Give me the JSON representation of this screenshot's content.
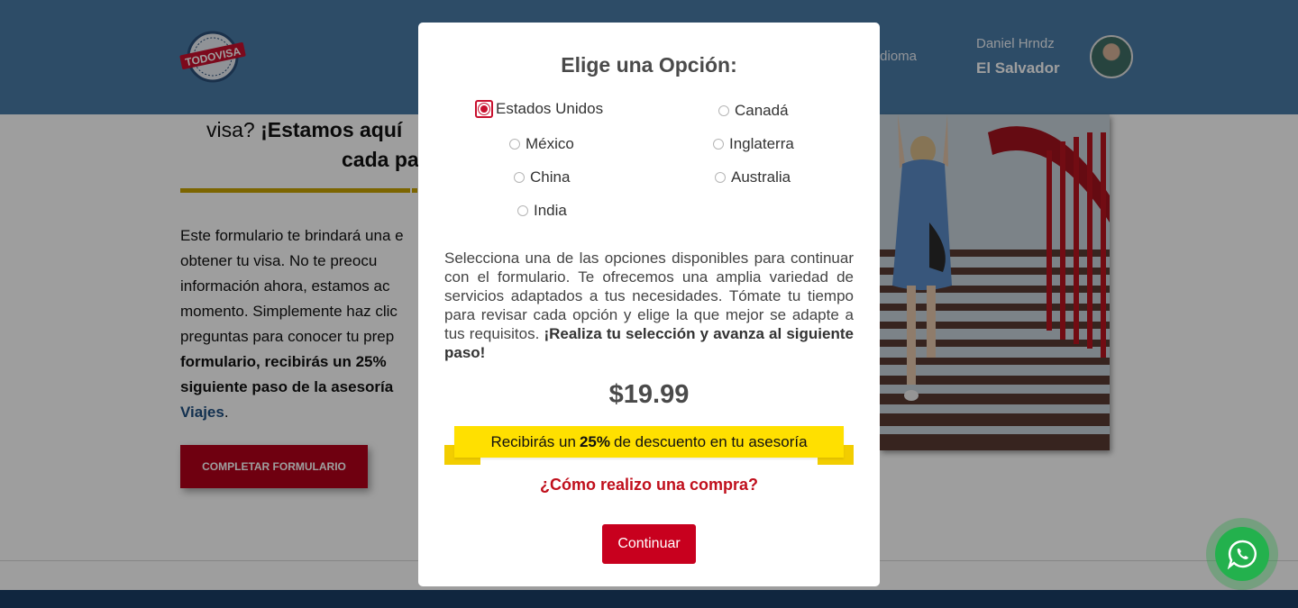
{
  "header": {
    "logo_text": "TODOVISA",
    "nav_idioma": "Idioma",
    "user_name": "Daniel Hrndz",
    "user_country": "El Salvador"
  },
  "hero": {
    "title_line1_prefix": "visa? ",
    "title_line1_bold": "¡Estamos aquí",
    "title_line2": "cada pa",
    "paragraph_lines": [
      "Este formulario te brindará una e",
      "obtener tu visa. No te preocu",
      "información ahora, estamos ac",
      "momento. Simplemente haz clic",
      "preguntas para conocer tu prep"
    ],
    "paragraph_bold_lines": [
      "formulario, recibirás un 25%",
      "siguiente paso de la asesoría"
    ],
    "paragraph_link": "Viajes",
    "paragraph_end": ".",
    "cta_label": "COMPLETAR FORMULARIO"
  },
  "modal": {
    "title": "Elige una Opción:",
    "options": [
      {
        "label": "Estados Unidos",
        "selected": true
      },
      {
        "label": "Canadá",
        "selected": false
      },
      {
        "label": "México",
        "selected": false
      },
      {
        "label": "Inglaterra",
        "selected": false
      },
      {
        "label": "China",
        "selected": false
      },
      {
        "label": "Australia",
        "selected": false
      },
      {
        "label": "India",
        "selected": false
      }
    ],
    "description": "Selecciona una de las opciones disponibles para continuar con el formulario. Te ofrecemos una amplia variedad de servicios adaptados a tus necesidades. Tómate tu tiempo para revisar cada opción y elige la que mejor se adapte a tus requisitos.",
    "description_bold": "¡Realiza tu selección y avanza al siguiente paso!",
    "price": "$19.99",
    "ribbon_prefix": "Recibirás un",
    "ribbon_bold": "25%",
    "ribbon_suffix": "de descuento en tu asesoría",
    "how_link": "¿Cómo realizo una compra?",
    "continue_label": "Continuar"
  },
  "colors": {
    "header": "#4a7ba6",
    "accent_red": "#c8001e",
    "ribbon_yellow": "#ffe000",
    "footer": "#1b3e66",
    "whatsapp": "#23b14d"
  }
}
